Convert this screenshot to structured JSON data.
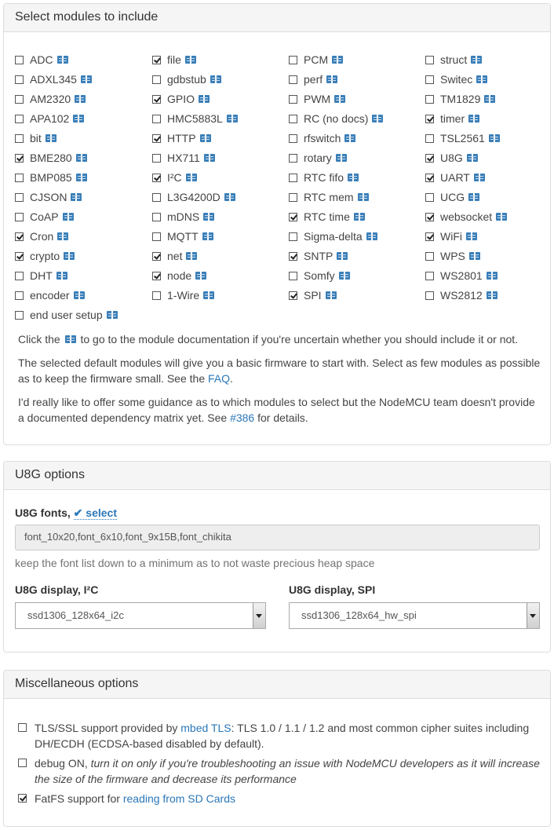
{
  "modules_panel": {
    "title": "Select modules to include",
    "columns": [
      [
        {
          "name": "ADC",
          "checked": false
        },
        {
          "name": "ADXL345",
          "checked": false
        },
        {
          "name": "AM2320",
          "checked": false
        },
        {
          "name": "APA102",
          "checked": false
        },
        {
          "name": "bit",
          "checked": false
        },
        {
          "name": "BME280",
          "checked": true
        },
        {
          "name": "BMP085",
          "checked": false
        },
        {
          "name": "CJSON",
          "checked": false
        },
        {
          "name": "CoAP",
          "checked": false
        },
        {
          "name": "Cron",
          "checked": true
        },
        {
          "name": "crypto",
          "checked": true
        },
        {
          "name": "DHT",
          "checked": false
        },
        {
          "name": "encoder",
          "checked": false
        },
        {
          "name": "end user setup",
          "checked": false
        }
      ],
      [
        {
          "name": "file",
          "checked": true
        },
        {
          "name": "gdbstub",
          "checked": false
        },
        {
          "name": "GPIO",
          "checked": true
        },
        {
          "name": "HMC5883L",
          "checked": false
        },
        {
          "name": "HTTP",
          "checked": true
        },
        {
          "name": "HX711",
          "checked": false
        },
        {
          "name": "I²C",
          "checked": true
        },
        {
          "name": "L3G4200D",
          "checked": false
        },
        {
          "name": "mDNS",
          "checked": false
        },
        {
          "name": "MQTT",
          "checked": false
        },
        {
          "name": "net",
          "checked": true
        },
        {
          "name": "node",
          "checked": true
        },
        {
          "name": "1-Wire",
          "checked": false
        }
      ],
      [
        {
          "name": "PCM",
          "checked": false
        },
        {
          "name": "perf",
          "checked": false
        },
        {
          "name": "PWM",
          "checked": false
        },
        {
          "name": "RC (no docs)",
          "checked": false,
          "nodoc": true
        },
        {
          "name": "rfswitch",
          "checked": false
        },
        {
          "name": "rotary",
          "checked": false
        },
        {
          "name": "RTC fifo",
          "checked": false
        },
        {
          "name": "RTC mem",
          "checked": false
        },
        {
          "name": "RTC time",
          "checked": true
        },
        {
          "name": "Sigma-delta",
          "checked": false
        },
        {
          "name": "SNTP",
          "checked": true
        },
        {
          "name": "Somfy",
          "checked": false
        },
        {
          "name": "SPI",
          "checked": true
        }
      ],
      [
        {
          "name": "struct",
          "checked": false
        },
        {
          "name": "Switec",
          "checked": false
        },
        {
          "name": "TM1829",
          "checked": false
        },
        {
          "name": "timer",
          "checked": true
        },
        {
          "name": "TSL2561",
          "checked": false
        },
        {
          "name": "U8G",
          "checked": true
        },
        {
          "name": "UART",
          "checked": true
        },
        {
          "name": "UCG",
          "checked": false
        },
        {
          "name": "websocket",
          "checked": true
        },
        {
          "name": "WiFi",
          "checked": true
        },
        {
          "name": "WPS",
          "checked": false
        },
        {
          "name": "WS2801",
          "checked": false
        },
        {
          "name": "WS2812",
          "checked": false
        }
      ]
    ],
    "hint_before": "Click the",
    "hint_after": "to go to the module documentation if you're uncertain whether you should include it or not.",
    "para2_text": "The selected default modules will give you a basic firmware to start with. Select as few modules as possible as to keep the firmware small. See the",
    "para2_link": "FAQ",
    "para2_end": ".",
    "para3_text": "I'd really like to offer some guidance as to which modules to select but the NodeMCU team doesn't provide a documented dependency matrix yet. See",
    "para3_link": "#386",
    "para3_end": "for details."
  },
  "u8g_panel": {
    "title": "U8G options",
    "fonts_label": "U8G fonts,",
    "fonts_select": "✔ select",
    "fonts_value": "font_10x20,font_6x10,font_9x15B,font_chikita",
    "fonts_help": "keep the font list down to a minimum as to not waste precious heap space",
    "i2c_label": "U8G display, I²C",
    "i2c_value": "ssd1306_128x64_i2c",
    "spi_label": "U8G display, SPI",
    "spi_value": "ssd1306_128x64_hw_spi"
  },
  "misc_panel": {
    "title": "Miscellaneous options",
    "tls_pre": "TLS/SSL support provided by",
    "tls_link": "mbed TLS",
    "tls_post": ": TLS 1.0 / 1.1 / 1.2 and most common cipher suites including DH/ECDH (ECDSA-based disabled by default).",
    "tls_checked": false,
    "debug_pre": "debug ON,",
    "debug_em": "turn it on only if you're troubleshooting an issue with NodeMCU developers as it will increase the size of the firmware and decrease its performance",
    "debug_checked": false,
    "fatfs_pre": "FatFS support for",
    "fatfs_link": "reading from SD Cards",
    "fatfs_checked": true
  }
}
